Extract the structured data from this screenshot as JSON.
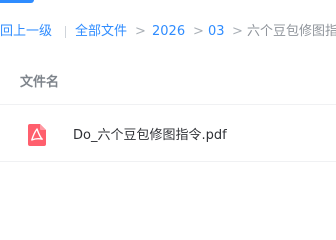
{
  "breadcrumb": {
    "back": "回上一级",
    "all_files": "全部文件",
    "year": "2026",
    "month": "03",
    "current": "六个豆包修图指令"
  },
  "table": {
    "column_name": "文件名"
  },
  "files": [
    {
      "name": "Do_六个豆包修图指令.pdf",
      "icon": "pdf-file-icon"
    }
  ],
  "colors": {
    "accent": "#2f8cff",
    "pdf_icon": "#ff5f6d",
    "text": "#2f3136",
    "muted": "#8f949b"
  }
}
